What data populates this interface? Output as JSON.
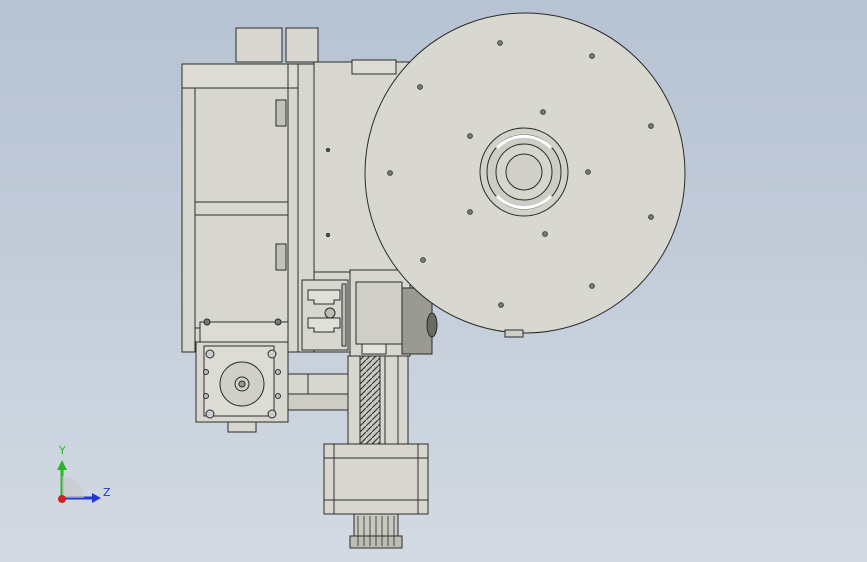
{
  "view": {
    "background_top": "#b7c3d3",
    "background_bottom": "#d3dae3",
    "part_fill": "#d7d7cf",
    "part_stroke": "#2b2b2b"
  },
  "triad": {
    "y_label": "Y",
    "z_label": "Z",
    "y_color": "#2bb52b",
    "z_color": "#2337d6",
    "x_color": "#d22121"
  }
}
